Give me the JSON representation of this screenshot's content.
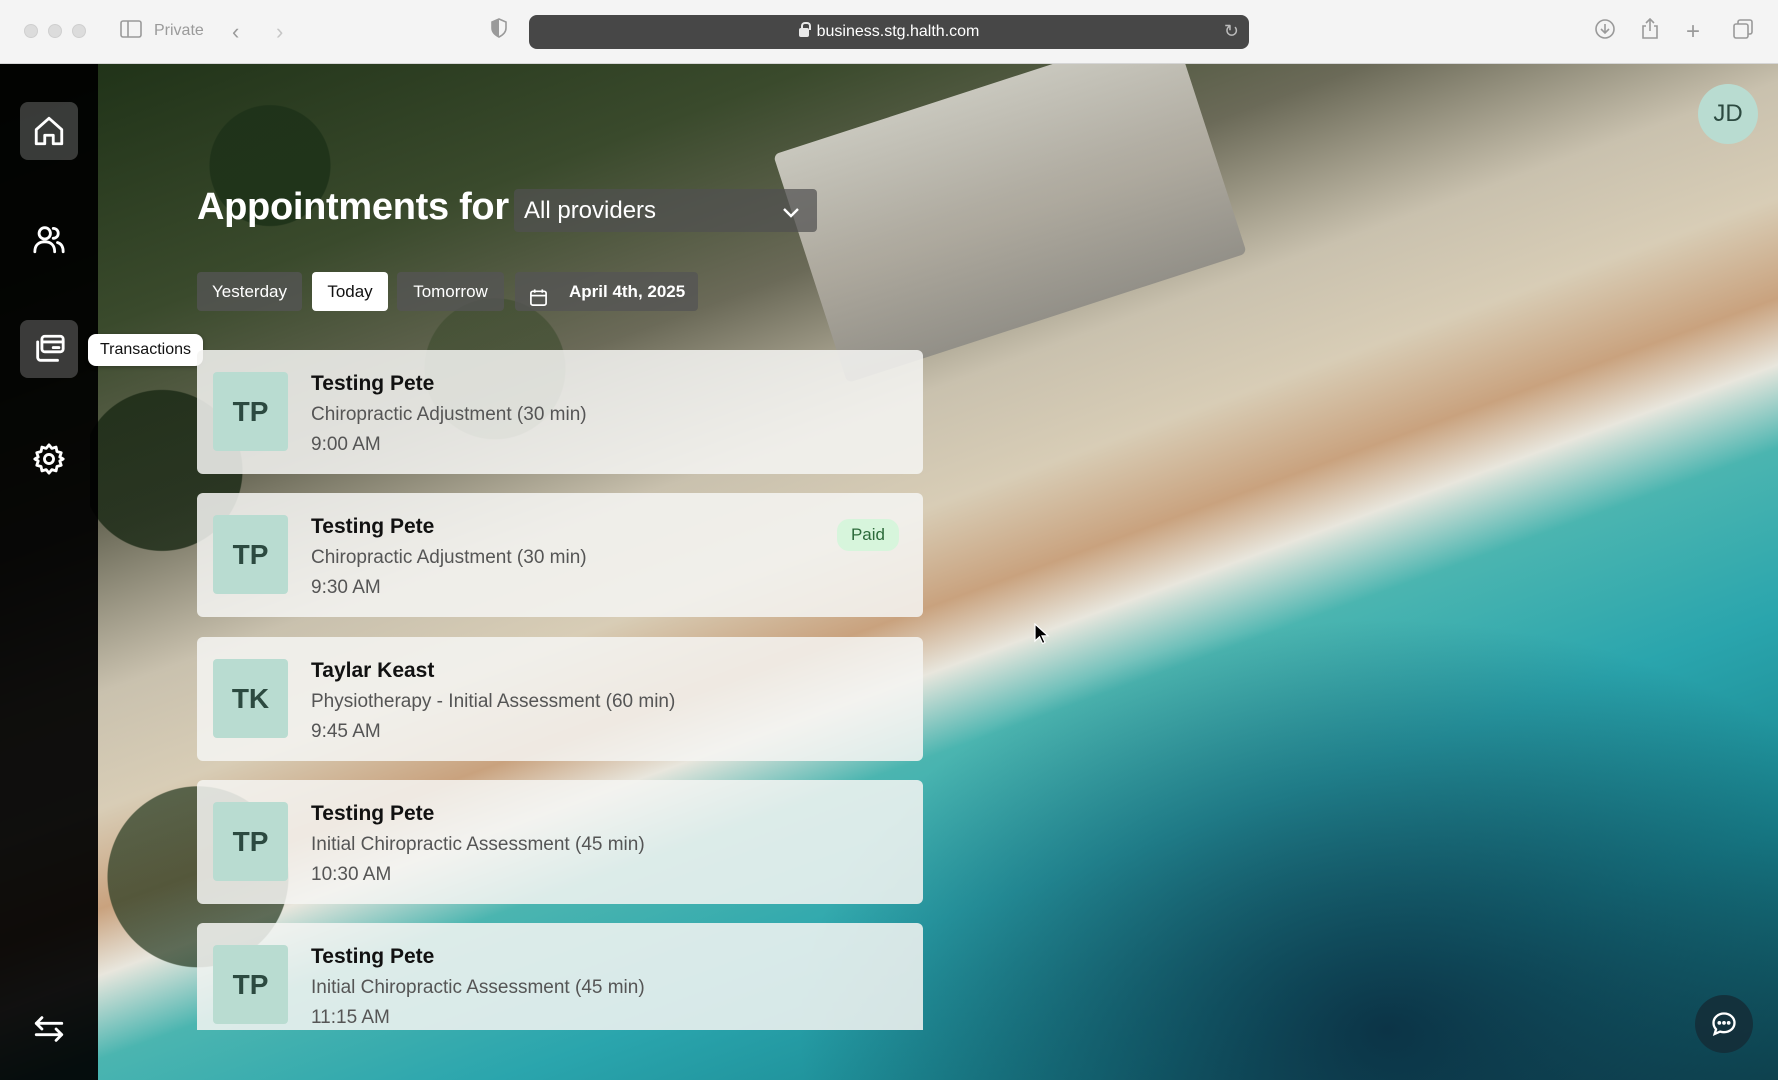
{
  "browser": {
    "private_label": "Private",
    "url": "business.stg.halth.com"
  },
  "sidebar": {
    "items": [
      {
        "name": "home",
        "icon": "home-icon"
      },
      {
        "name": "clients",
        "icon": "users-icon"
      },
      {
        "name": "transactions",
        "icon": "transactions-icon"
      },
      {
        "name": "settings",
        "icon": "gear-icon"
      },
      {
        "name": "switch",
        "icon": "swap-arrows-icon"
      }
    ],
    "tooltip": "Transactions"
  },
  "header": {
    "title": "Appointments for",
    "provider_select": "All providers"
  },
  "date_nav": {
    "yesterday": "Yesterday",
    "today": "Today",
    "tomorrow": "Tomorrow",
    "date": "April 4th, 2025"
  },
  "appointments": [
    {
      "initials": "TP",
      "name": "Testing Pete",
      "service": "Chiropractic Adjustment (30 min)",
      "time": "9:00 AM",
      "badge": ""
    },
    {
      "initials": "TP",
      "name": "Testing Pete",
      "service": "Chiropractic Adjustment (30 min)",
      "time": "9:30 AM",
      "badge": "Paid"
    },
    {
      "initials": "TK",
      "name": "Taylar Keast",
      "service": "Physiotherapy - Initial Assessment (60 min)",
      "time": "9:45 AM",
      "badge": ""
    },
    {
      "initials": "TP",
      "name": "Testing Pete",
      "service": "Initial Chiropractic Assessment (45 min)",
      "time": "10:30 AM",
      "badge": ""
    },
    {
      "initials": "TP",
      "name": "Testing Pete",
      "service": "Initial Chiropractic Assessment (45 min)",
      "time": "11:15 AM",
      "badge": ""
    }
  ],
  "user": {
    "initials": "JD"
  },
  "colors": {
    "accent_avatar": "#b9dcd1",
    "paid_badge": "#d7f5dc",
    "sidebar": "#000000"
  }
}
